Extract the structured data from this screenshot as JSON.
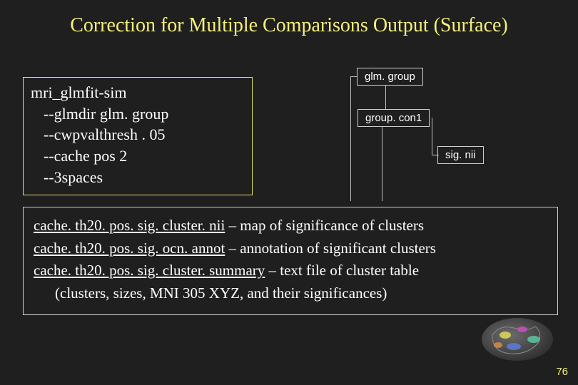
{
  "title": "Correction for Multiple Comparisons Output (Surface)",
  "command": {
    "name": "mri_glmfit-sim",
    "args": [
      "--glmdir glm. group",
      "--cwpvalthresh . 05",
      "--cache pos 2",
      "--3spaces"
    ]
  },
  "diagram": {
    "node1": "glm. group",
    "node2": "group. con1",
    "node3": "sig. nii"
  },
  "outputs": {
    "line1_file": "cache. th20. pos. sig. cluster. nii",
    "line1_desc": " – map of significance of clusters",
    "line2_file": "cache. th20. pos. sig. ocn. annot",
    "line2_desc": " – annotation of significant clusters",
    "line3_file": "cache. th20. pos. sig. cluster. summary",
    "line3_desc": " – text file of cluster table",
    "line4": "(clusters, sizes, MNI 305 XYZ, and their significances)"
  },
  "page_number": "76"
}
